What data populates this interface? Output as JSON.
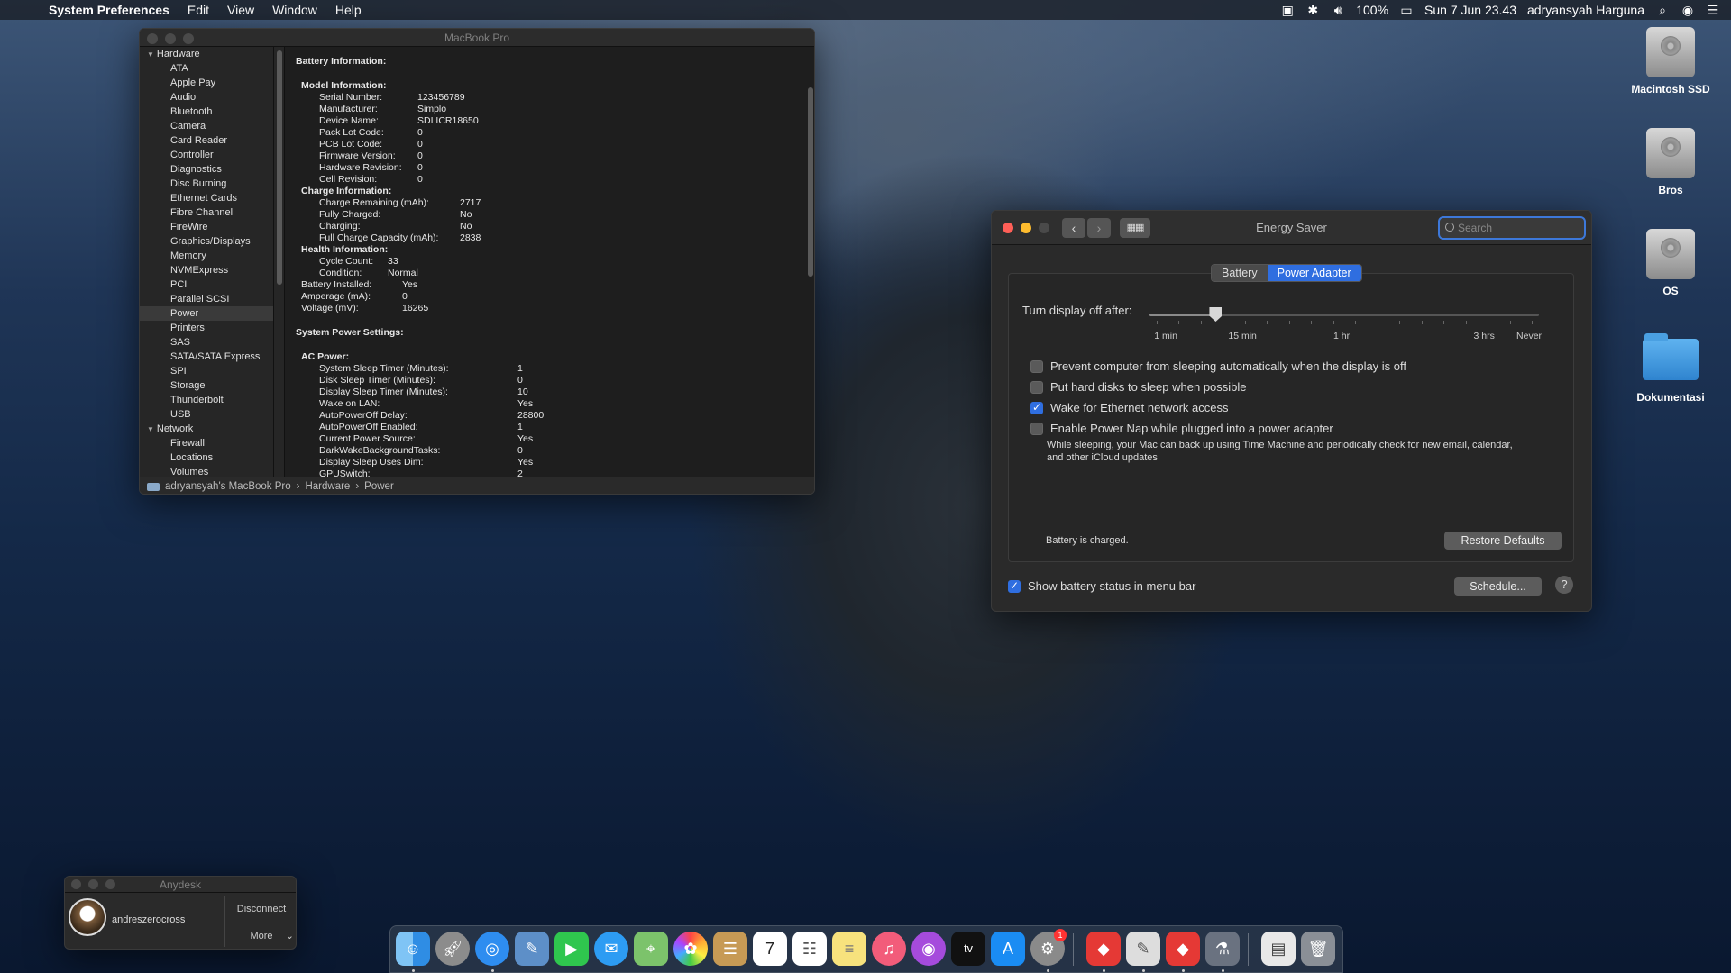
{
  "menubar": {
    "app": "System Preferences",
    "items": [
      "Edit",
      "View",
      "Window",
      "Help"
    ],
    "battery": "100%",
    "datetime": "Sun 7 Jun  23.43",
    "user": "adryansyah Harguna"
  },
  "desktop": {
    "icons": [
      "Macintosh SSD",
      "Bros",
      "OS",
      "Dokumentasi"
    ]
  },
  "sysinfo": {
    "title": "MacBook Pro",
    "sidebar": {
      "hardware_label": "Hardware",
      "hardware_items": [
        "ATA",
        "Apple Pay",
        "Audio",
        "Bluetooth",
        "Camera",
        "Card Reader",
        "Controller",
        "Diagnostics",
        "Disc Burning",
        "Ethernet Cards",
        "Fibre Channel",
        "FireWire",
        "Graphics/Displays",
        "Memory",
        "NVMExpress",
        "PCI",
        "Parallel SCSI",
        "Power",
        "Printers",
        "SAS",
        "SATA/SATA Express",
        "SPI",
        "Storage",
        "Thunderbolt",
        "USB"
      ],
      "network_label": "Network",
      "network_items": [
        "Firewall",
        "Locations",
        "Volumes"
      ]
    },
    "battery_heading": "Battery Information:",
    "model_heading": "Model Information:",
    "model": [
      [
        "Serial Number:",
        "123456789"
      ],
      [
        "Manufacturer:",
        "Simplo"
      ],
      [
        "Device Name:",
        "SDI ICR18650"
      ],
      [
        "Pack Lot Code:",
        "0"
      ],
      [
        "PCB Lot Code:",
        "0"
      ],
      [
        "Firmware Version:",
        "0"
      ],
      [
        "Hardware Revision:",
        "0"
      ],
      [
        "Cell Revision:",
        "0"
      ]
    ],
    "charge_heading": "Charge Information:",
    "charge": [
      [
        "Charge Remaining (mAh):",
        "2717"
      ],
      [
        "Fully Charged:",
        "No"
      ],
      [
        "Charging:",
        "No"
      ],
      [
        "Full Charge Capacity (mAh):",
        "2838"
      ]
    ],
    "health_heading": "Health Information:",
    "health": [
      [
        "Cycle Count:",
        "33"
      ],
      [
        "Condition:",
        "Normal"
      ]
    ],
    "battery_misc": [
      [
        "Battery Installed:",
        "Yes"
      ],
      [
        "Amperage (mA):",
        "0"
      ],
      [
        "Voltage (mV):",
        "16265"
      ]
    ],
    "power_heading": "System Power Settings:",
    "ac_heading": "AC Power:",
    "ac": [
      [
        "System Sleep Timer (Minutes):",
        "1"
      ],
      [
        "Disk Sleep Timer (Minutes):",
        "0"
      ],
      [
        "Display Sleep Timer (Minutes):",
        "10"
      ],
      [
        "Wake on LAN:",
        "Yes"
      ],
      [
        "AutoPowerOff Delay:",
        "28800"
      ],
      [
        "AutoPowerOff Enabled:",
        "1"
      ],
      [
        "Current Power Source:",
        "Yes"
      ],
      [
        "DarkWakeBackgroundTasks:",
        "0"
      ],
      [
        "Display Sleep Uses Dim:",
        "Yes"
      ],
      [
        "GPUSwitch:",
        "2"
      ]
    ],
    "path": [
      "adryansyah's MacBook Pro",
      "Hardware",
      "Power"
    ]
  },
  "energy": {
    "title": "Energy Saver",
    "search_placeholder": "Search",
    "tabs": [
      "Battery",
      "Power Adapter"
    ],
    "active_tab": 1,
    "slider_label": "Turn display off after:",
    "slider_ticks": [
      "1 min",
      "15 min",
      "1 hr",
      "3 hrs",
      "Never"
    ],
    "slider_value_fraction": 0.17,
    "options": [
      {
        "label": "Prevent computer from sleeping automatically when the display is off",
        "checked": false
      },
      {
        "label": "Put hard disks to sleep when possible",
        "checked": false
      },
      {
        "label": "Wake for Ethernet network access",
        "checked": true
      },
      {
        "label": "Enable Power Nap while plugged into a power adapter",
        "checked": false
      }
    ],
    "power_nap_desc": "While sleeping, your Mac can back up using Time Machine and periodically check for new email, calendar, and other iCloud updates",
    "status": "Battery is charged.",
    "restore_button": "Restore Defaults",
    "show_battery_label": "Show battery status in menu bar",
    "show_battery_checked": true,
    "schedule_button": "Schedule...",
    "help": "?"
  },
  "anydesk": {
    "title": "Anydesk",
    "user": "andreszerocross",
    "disconnect": "Disconnect",
    "more": "More"
  },
  "dock": {
    "badge": "1",
    "calendar_day": "7",
    "tv_label": "tv"
  }
}
